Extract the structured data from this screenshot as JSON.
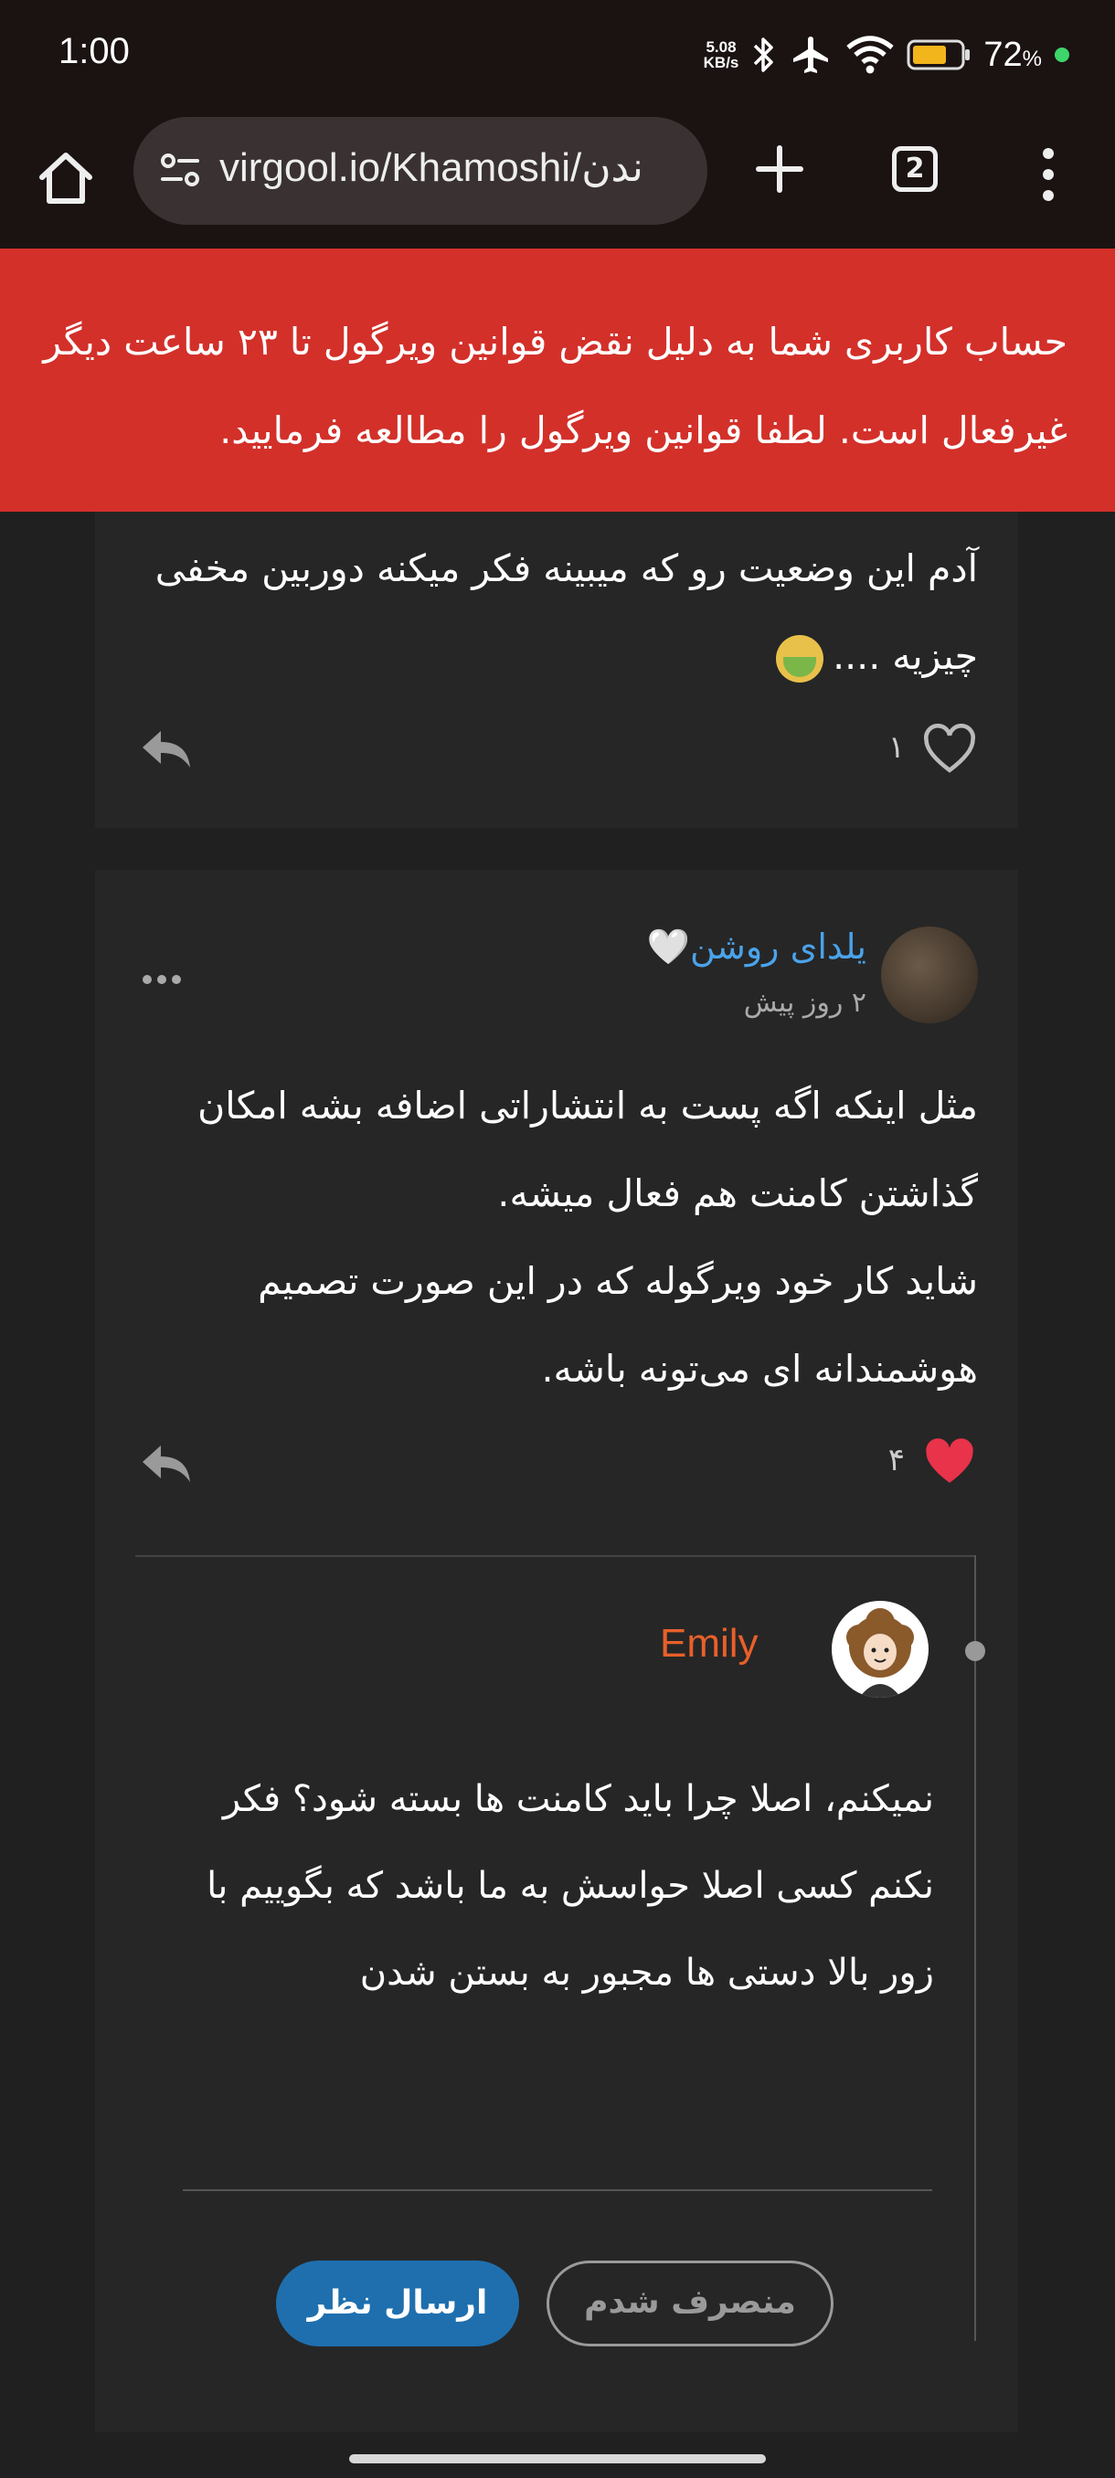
{
  "status_bar": {
    "time": "1:00",
    "net_speed_value": "5.08",
    "net_speed_unit": "KB/s",
    "battery_percent": "72",
    "battery_percent_sign": "%",
    "battery_level": 0.72
  },
  "browser": {
    "url": "virgool.io/Khamoshi/ندن",
    "tab_count": "2"
  },
  "banner": {
    "message": "حساب کاربری شما به دلیل نقض قوانین ویرگول تا ۲۳ ساعت دیگر غیرفعال است. لطفا قوانین ویرگول را مطالعه فرمایید."
  },
  "comment1": {
    "text": "آدم این وضعیت رو که میبینه فکر میکنه دوربین مخفی چیزیه ....",
    "likes": "۱"
  },
  "comment2": {
    "author": "یلدای روشن",
    "author_heart": "🤍",
    "time": "۲ روز پیش",
    "text_line1": "مثل اینکه اگه پست به انتشاراتی اضافه بشه امکان گذاشتن کامنت هم فعال میشه.",
    "text_line2": "شاید کار خود ویرگوله که در این صورت تصمیم هوشمندانه ای می‌تونه باشه.",
    "likes": "۴"
  },
  "reply": {
    "author": "Emily",
    "text": "نمیکنم، اصلا چرا باید کامنت ها بسته شود؟ فکر نکنم کسی اصلا حواسش به ما باشد که بگوییم با زور بالا دستی ها مجبور به بستن شدن"
  },
  "buttons": {
    "cancel": "منصرف شدم",
    "submit": "ارسال نظر"
  },
  "colors": {
    "banner": "#d3302a",
    "card": "#262626",
    "author_link": "#4aa3ea",
    "reply_author": "#e8602a",
    "liked_heart": "#e8334a",
    "submit_button": "#1f6fae"
  }
}
